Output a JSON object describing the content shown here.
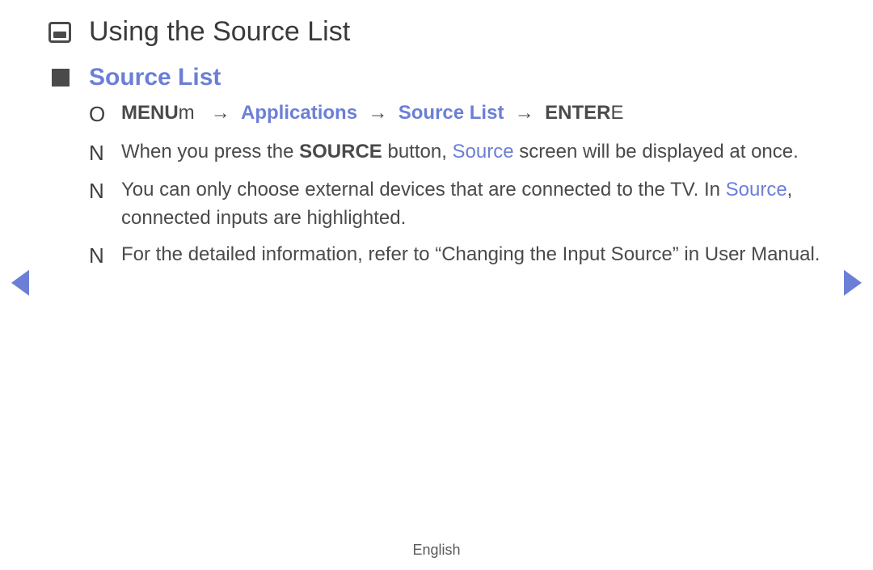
{
  "title": "Using the Source List",
  "section": "Source List",
  "nav": {
    "menu_prefix": "MENU",
    "menu_suffix": "m",
    "arrow": "→",
    "applications": "Applications",
    "source_list": "Source List",
    "enter_prefix": "ENTER",
    "enter_suffix": "E"
  },
  "notes": [
    {
      "parts": [
        {
          "text": "When you press the "
        },
        {
          "text": "SOURCE",
          "bold": true
        },
        {
          "text": " button, "
        },
        {
          "text": "Source",
          "blue": true
        },
        {
          "text": " screen will be displayed at once."
        }
      ]
    },
    {
      "parts": [
        {
          "text": "You can only choose external devices that are connected to the TV. In "
        },
        {
          "text": "Source",
          "blue": true
        },
        {
          "text": ", connected inputs are highlighted."
        }
      ]
    },
    {
      "parts": [
        {
          "text": "For the detailed information, refer to “Changing the Input Source” in User Manual."
        }
      ]
    }
  ],
  "markers": {
    "nav": "O",
    "note": "N"
  },
  "footer": "English"
}
